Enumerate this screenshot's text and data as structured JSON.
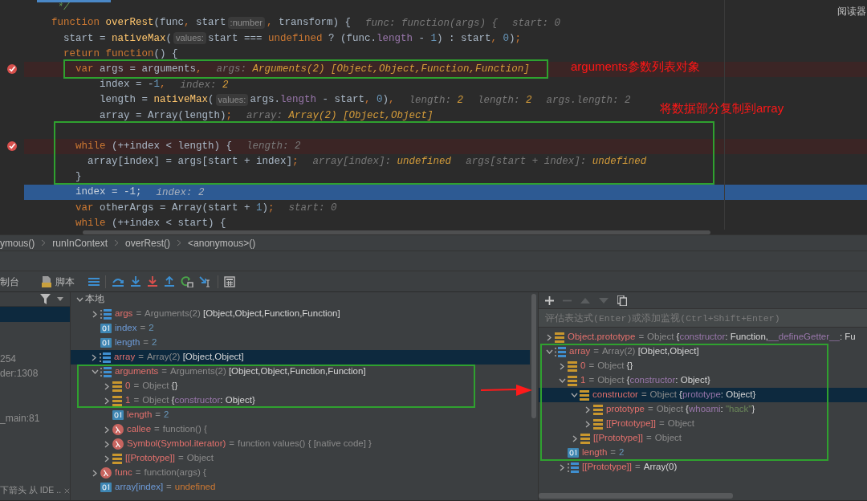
{
  "editor": {
    "reader_label": "阅读器",
    "lines": [
      {
        "breakpoint": false,
        "current": false,
        "segments": [
          {
            "kind": "cmt",
            "text": " */"
          }
        ]
      },
      {
        "breakpoint": false,
        "current": false,
        "segments": [
          {
            "kind": "kw",
            "text": "function "
          },
          {
            "kind": "fn",
            "text": "overRest"
          },
          {
            "kind": "plain",
            "text": "(func"
          },
          {
            "kind": "kw",
            "text": ","
          },
          {
            "kind": "plain",
            "text": " start"
          },
          {
            "kind": "param",
            "text": ":number"
          },
          {
            "kind": "kw",
            "text": ","
          },
          {
            "kind": "plain",
            "text": " transform) {"
          },
          {
            "kind": "hint",
            "text": "func: function(args) {"
          },
          {
            "kind": "hint",
            "text": "start: 0"
          }
        ]
      },
      {
        "breakpoint": false,
        "current": false,
        "segments": [
          {
            "kind": "plain",
            "text": "  start = "
          },
          {
            "kind": "fn",
            "text": "nativeMax"
          },
          {
            "kind": "plain",
            "text": "("
          },
          {
            "kind": "param",
            "text": "values:"
          },
          {
            "kind": "plain",
            "text": "start === "
          },
          {
            "kind": "kw",
            "text": "undefined"
          },
          {
            "kind": "plain",
            "text": " ? (func."
          },
          {
            "kind": "prop",
            "text": "length"
          },
          {
            "kind": "plain",
            "text": " - "
          },
          {
            "kind": "num",
            "text": "1"
          },
          {
            "kind": "plain",
            "text": ") : start"
          },
          {
            "kind": "kw",
            "text": ", "
          },
          {
            "kind": "num",
            "text": "0"
          },
          {
            "kind": "plain",
            "text": ")"
          },
          {
            "kind": "kw",
            "text": ";"
          }
        ]
      },
      {
        "breakpoint": false,
        "current": false,
        "segments": [
          {
            "kind": "kw",
            "text": "  return function"
          },
          {
            "kind": "plain",
            "text": "() {"
          }
        ]
      },
      {
        "breakpoint": true,
        "current": false,
        "segments": [
          {
            "kind": "kw",
            "text": "    var"
          },
          {
            "kind": "plain",
            "text": " args = arguments"
          },
          {
            "kind": "kw",
            "text": ","
          },
          {
            "kind": "hint",
            "text": "args:"
          },
          {
            "kind": "hv",
            "text": " Arguments(2) [Object,Object,Function,Function]"
          }
        ]
      },
      {
        "breakpoint": false,
        "current": false,
        "segments": [
          {
            "kind": "plain",
            "text": "        index = -"
          },
          {
            "kind": "num",
            "text": "1"
          },
          {
            "kind": "kw",
            "text": ","
          },
          {
            "kind": "hint",
            "text": "index:"
          },
          {
            "kind": "hv",
            "text": " 2"
          }
        ]
      },
      {
        "breakpoint": false,
        "current": false,
        "segments": [
          {
            "kind": "plain",
            "text": "        length = "
          },
          {
            "kind": "fn",
            "text": "nativeMax"
          },
          {
            "kind": "plain",
            "text": "("
          },
          {
            "kind": "param",
            "text": "values:"
          },
          {
            "kind": "plain",
            "text": "args."
          },
          {
            "kind": "prop",
            "text": "length"
          },
          {
            "kind": "plain",
            "text": " - start"
          },
          {
            "kind": "kw",
            "text": ", "
          },
          {
            "kind": "num",
            "text": "0"
          },
          {
            "kind": "plain",
            "text": ")"
          },
          {
            "kind": "kw",
            "text": ","
          },
          {
            "kind": "hint",
            "text": "length:"
          },
          {
            "kind": "hv",
            "text": " 2"
          },
          {
            "kind": "hint",
            "text": "length:"
          },
          {
            "kind": "hv",
            "text": " 2"
          },
          {
            "kind": "hint",
            "text": "args.length: 2"
          }
        ]
      },
      {
        "breakpoint": false,
        "current": false,
        "segments": [
          {
            "kind": "plain",
            "text": "        array = Array(length)"
          },
          {
            "kind": "kw",
            "text": ";"
          },
          {
            "kind": "hint",
            "text": "array:"
          },
          {
            "kind": "hv",
            "text": " Array(2) [Object,Object]"
          }
        ]
      },
      {
        "breakpoint": false,
        "current": false
      },
      {
        "breakpoint": true,
        "current": false,
        "segments": [
          {
            "kind": "kw",
            "text": "    while"
          },
          {
            "kind": "plain",
            "text": " (++index < length) {"
          },
          {
            "kind": "hint",
            "text": "length: 2"
          }
        ]
      },
      {
        "breakpoint": false,
        "current": false,
        "segments": [
          {
            "kind": "plain",
            "text": "      array[index] = args[start + index]"
          },
          {
            "kind": "kw",
            "text": ";"
          },
          {
            "kind": "hint",
            "text": "array[index]:"
          },
          {
            "kind": "hv",
            "text": " undefined"
          },
          {
            "kind": "hint",
            "text": "args[start + index]:"
          },
          {
            "kind": "hv",
            "text": " undefined"
          }
        ]
      },
      {
        "breakpoint": false,
        "current": false,
        "segments": [
          {
            "kind": "plain",
            "text": "    }"
          }
        ]
      },
      {
        "breakpoint": false,
        "current": true,
        "segments": [
          {
            "kind": "plain",
            "text": "    index = -"
          },
          {
            "kind": "num",
            "text": "1"
          },
          {
            "kind": "kw",
            "text": ";"
          },
          {
            "kind": "hint",
            "text": "index: 2"
          }
        ]
      },
      {
        "breakpoint": false,
        "current": false,
        "segments": [
          {
            "kind": "kw",
            "text": "    var"
          },
          {
            "kind": "plain",
            "text": " otherArgs = Array(start + "
          },
          {
            "kind": "num",
            "text": "1"
          },
          {
            "kind": "plain",
            "text": ")"
          },
          {
            "kind": "kw",
            "text": ";"
          },
          {
            "kind": "hint",
            "text": "start: 0"
          }
        ]
      },
      {
        "breakpoint": false,
        "current": false,
        "segments": [
          {
            "kind": "kw",
            "text": "    while"
          },
          {
            "kind": "plain",
            "text": " (++index < start) {"
          }
        ]
      }
    ]
  },
  "breadcrumb": [
    "ymous()",
    "runInContext",
    "overRest()",
    "<anonymous>()"
  ],
  "debug_tabs": [
    {
      "label": "制台"
    },
    {
      "label": "脚本"
    }
  ],
  "frames": [
    {
      "selected": true
    },
    {
      "selected": false
    },
    {
      "selected": false
    },
    {
      "text": "254",
      "selected": false
    },
    {
      "text": "der:1308",
      "selected": false
    },
    {
      "selected": false
    },
    {
      "selected": false
    },
    {
      "text": "_main:81",
      "selected": false
    }
  ],
  "notification": {
    "text": "下箭头 从 IDE .."
  },
  "variables": [
    {
      "name": "本地",
      "kind": "scope",
      "expanded": true,
      "selected": false,
      "children": [
        {
          "name": "args",
          "kind": "array",
          "expanded": false,
          "selected": false,
          "value": [
            {
              "kind": "eq",
              "text": "="
            },
            {
              "kind": "type",
              "text": "Arguments(2)"
            },
            {
              "kind": "text",
              "text": " [Object,Object,Function,Function]"
            }
          ]
        },
        {
          "name": "index",
          "kind": "primitive",
          "selected": false,
          "value": [
            {
              "kind": "eq",
              "text": "="
            },
            {
              "kind": "num",
              "text": "2"
            }
          ]
        },
        {
          "name": "length",
          "kind": "primitive",
          "selected": false,
          "value": [
            {
              "kind": "eq",
              "text": "="
            },
            {
              "kind": "num",
              "text": "2"
            }
          ]
        },
        {
          "name": "array",
          "kind": "array",
          "expanded": false,
          "selected": true,
          "value": [
            {
              "kind": "eq",
              "text": "="
            },
            {
              "kind": "type",
              "text": "Array(2)"
            },
            {
              "kind": "text",
              "text": " [Object,Object]"
            }
          ]
        },
        {
          "name": "arguments",
          "kind": "array",
          "expanded": true,
          "selected": false,
          "value": [
            {
              "kind": "eq",
              "text": "="
            },
            {
              "kind": "type",
              "text": "Arguments(2)"
            },
            {
              "kind": "text",
              "text": " [Object,Object,Function,Function]"
            }
          ],
          "children": [
            {
              "name": "0",
              "kind": "object",
              "expanded": false,
              "selected": false,
              "value": [
                {
                  "kind": "eq",
                  "text": "="
                },
                {
                  "kind": "type",
                  "text": "Object"
                },
                {
                  "kind": "text",
                  "text": " {}"
                }
              ]
            },
            {
              "name": "1",
              "kind": "object",
              "expanded": false,
              "selected": false,
              "value": [
                {
                  "kind": "eq",
                  "text": "="
                },
                {
                  "kind": "type",
                  "text": "Object"
                },
                {
                  "kind": "text",
                  "text": " {"
                },
                {
                  "kind": "key",
                  "text": "constructor"
                },
                {
                  "kind": "text",
                  "text": ": Object}"
                }
              ]
            },
            {
              "name": "length",
              "kind": "primitive",
              "selected": false,
              "value": [
                {
                  "kind": "eq",
                  "text": "="
                },
                {
                  "kind": "num",
                  "text": "2"
                }
              ]
            },
            {
              "name": "callee",
              "kind": "function",
              "expanded": false,
              "selected": false,
              "value": [
                {
                  "kind": "eq",
                  "text": "="
                },
                {
                  "kind": "type",
                  "text": "function() {"
                }
              ]
            },
            {
              "name": "Symbol(Symbol.iterator)",
              "kind": "function",
              "expanded": false,
              "selected": false,
              "value": [
                {
                  "kind": "eq",
                  "text": "="
                },
                {
                  "kind": "type",
                  "text": "function values() { [native code] }"
                }
              ]
            },
            {
              "name": "[[Prototype]]",
              "kind": "object",
              "expanded": false,
              "selected": false,
              "value": [
                {
                  "kind": "eq",
                  "text": "="
                },
                {
                  "kind": "type",
                  "text": "Object"
                }
              ]
            }
          ]
        },
        {
          "name": "func",
          "kind": "function",
          "expanded": false,
          "selected": false,
          "value": [
            {
              "kind": "eq",
              "text": "="
            },
            {
              "kind": "type",
              "text": "function(args) {"
            }
          ]
        },
        {
          "name": "array[index]",
          "kind": "primitive",
          "selected": false,
          "value": [
            {
              "kind": "eq",
              "text": "="
            },
            {
              "kind": "undef",
              "text": "undefined"
            }
          ]
        }
      ]
    }
  ],
  "watch_toolbar": [
    {
      "disabled": false
    },
    {
      "disabled": true
    },
    {
      "disabled": true
    },
    {
      "disabled": true
    },
    {
      "disabled": false
    }
  ],
  "watch_input": {
    "placeholder": "评估表达式(Enter)或添加监视(Ctrl+Shift+Enter)"
  },
  "watches": [
    {
      "name": "Object.prototype",
      "kind": "object",
      "expanded": false,
      "selected": false,
      "value": [
        {
          "kind": "eq",
          "text": "="
        },
        {
          "kind": "type",
          "text": "Object"
        },
        {
          "kind": "text",
          "text": " {"
        },
        {
          "kind": "key",
          "text": "constructor"
        },
        {
          "kind": "text",
          "text": ": Function,"
        },
        {
          "kind": "key",
          "text": "__defineGetter__"
        },
        {
          "kind": "text",
          "text": ": Fu"
        }
      ]
    },
    {
      "name": "array",
      "kind": "array",
      "expanded": true,
      "selected": false,
      "value": [
        {
          "kind": "eq",
          "text": "="
        },
        {
          "kind": "type",
          "text": "Array(2)"
        },
        {
          "kind": "text",
          "text": " [Object,Object]"
        }
      ],
      "children": [
        {
          "name": "0",
          "kind": "object",
          "expanded": false,
          "selected": false,
          "value": [
            {
              "kind": "eq",
              "text": "="
            },
            {
              "kind": "type",
              "text": "Object"
            },
            {
              "kind": "text",
              "text": " {}"
            }
          ]
        },
        {
          "name": "1",
          "kind": "object",
          "expanded": true,
          "selected": false,
          "value": [
            {
              "kind": "eq",
              "text": "="
            },
            {
              "kind": "type",
              "text": "Object"
            },
            {
              "kind": "text",
              "text": " {"
            },
            {
              "kind": "key",
              "text": "constructor"
            },
            {
              "kind": "text",
              "text": ": Object}"
            }
          ],
          "children": [
            {
              "name": "constructor",
              "kind": "object",
              "expanded": true,
              "selected": true,
              "value": [
                {
                  "kind": "eq",
                  "text": "="
                },
                {
                  "kind": "type",
                  "text": "Object"
                },
                {
                  "kind": "text",
                  "text": " {"
                },
                {
                  "kind": "key",
                  "text": "prototype"
                },
                {
                  "kind": "text",
                  "text": ": Object}"
                }
              ],
              "children": [
                {
                  "name": "prototype",
                  "kind": "object",
                  "expanded": false,
                  "selected": false,
                  "value": [
                    {
                      "kind": "eq",
                      "text": "="
                    },
                    {
                      "kind": "type",
                      "text": "Object"
                    },
                    {
                      "kind": "text",
                      "text": " {"
                    },
                    {
                      "kind": "key",
                      "text": "whoami"
                    },
                    {
                      "kind": "text",
                      "text": ": "
                    },
                    {
                      "kind": "str",
                      "text": "\"hack\""
                    },
                    {
                      "kind": "text",
                      "text": "}"
                    }
                  ]
                },
                {
                  "name": "[[Prototype]]",
                  "kind": "object",
                  "expanded": false,
                  "selected": false,
                  "value": [
                    {
                      "kind": "eq",
                      "text": "="
                    },
                    {
                      "kind": "type",
                      "text": "Object"
                    }
                  ]
                }
              ]
            },
            {
              "name": "[[Prototype]]",
              "kind": "object",
              "expanded": false,
              "selected": false,
              "value": [
                {
                  "kind": "eq",
                  "text": "="
                },
                {
                  "kind": "type",
                  "text": "Object"
                }
              ]
            }
          ]
        },
        {
          "name": "length",
          "kind": "primitive",
          "selected": false,
          "value": [
            {
              "kind": "eq",
              "text": "="
            },
            {
              "kind": "num",
              "text": "2"
            }
          ]
        },
        {
          "name": "[[Prototype]]",
          "kind": "array",
          "expanded": false,
          "selected": false,
          "value": [
            {
              "kind": "eq",
              "text": "="
            },
            {
              "kind": "text",
              "text": "Array(0)"
            }
          ]
        }
      ]
    }
  ],
  "annotations": [
    {
      "kind": "note",
      "text": "arguments参数列表对象"
    },
    {
      "kind": "note",
      "text": "将数据部分复制到array"
    }
  ]
}
